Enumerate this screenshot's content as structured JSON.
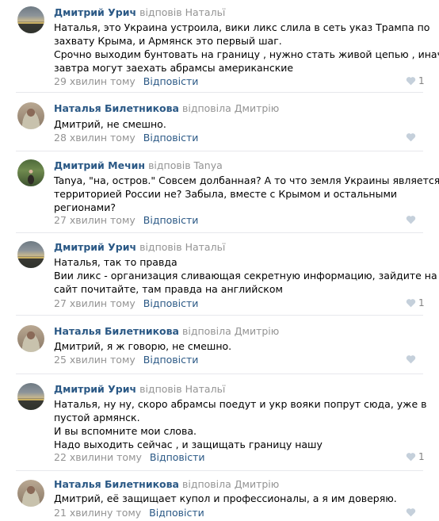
{
  "comments": [
    {
      "author": "Дмитрий Урич",
      "replied": "відповів Натальї",
      "lines": [
        "Наталья, это Украина устроила, вики ликс слила в сеть указ Трампа по",
        "захвату Крыма, и Армянск это первый шаг.",
        "Срочно выходим бунтовать на границу , нужно стать живой цепью , иначе",
        "завтра могут заехать абрамсы американские"
      ],
      "time": "29 хвилин тому",
      "reply": "Відповісти",
      "likes": "1",
      "avatar": "landscape-avatar"
    },
    {
      "author": "Наталья Билетникова",
      "replied": "відповіла Дмитрію",
      "lines": [
        "Дмитрий, не смешно."
      ],
      "time": "28 хвилин тому",
      "reply": "Відповісти",
      "likes": "",
      "avatar": "woman-avatar"
    },
    {
      "author": "Дмитрий Мечин",
      "replied": "відповів Tanya",
      "lines": [
        "Tanya, \"на, остров.\" Совсем долбанная? А то что земля Украины является",
        "территорией России не? Забыла, вместе с Крымом и остальными",
        "регионами?"
      ],
      "time": "27 хвилин тому",
      "reply": "Відповісти",
      "likes": "",
      "avatar": "forest-avatar"
    },
    {
      "author": "Дмитрий Урич",
      "replied": "відповів Натальї",
      "lines": [
        "Наталья, так то правда",
        "Вии ликс - организация сливающая секретную информацию, зайдите на",
        "сайт почитайте, там правда на английском"
      ],
      "time": "27 хвилин тому",
      "reply": "Відповісти",
      "likes": "1",
      "avatar": "landscape-avatar"
    },
    {
      "author": "Наталья Билетникова",
      "replied": "відповіла Дмитрію",
      "lines": [
        "Дмитрий, я ж говорю, не смешно."
      ],
      "time": "25 хвилин тому",
      "reply": "Відповісти",
      "likes": "",
      "avatar": "woman-avatar"
    },
    {
      "author": "Дмитрий Урич",
      "replied": "відповів Натальї",
      "lines": [
        "Наталья, ну ну, скоро абрамсы поедут и укр вояки попрут сюда, уже в",
        "пустой армянск.",
        "И вы вспомните мои слова.",
        "Надо выходить сейчас , и защищать границу нашу"
      ],
      "time": "22 хвилини тому",
      "reply": "Відповісти",
      "likes": "1",
      "avatar": "landscape-avatar"
    },
    {
      "author": "Наталья Билетникова",
      "replied": "відповіла Дмитрію",
      "lines": [
        "Дмитрий, её защищает купол и профессионалы, а я им доверяю."
      ],
      "time": "21 хвилину тому",
      "reply": "Відповісти",
      "likes": "",
      "avatar": "woman-avatar"
    }
  ]
}
